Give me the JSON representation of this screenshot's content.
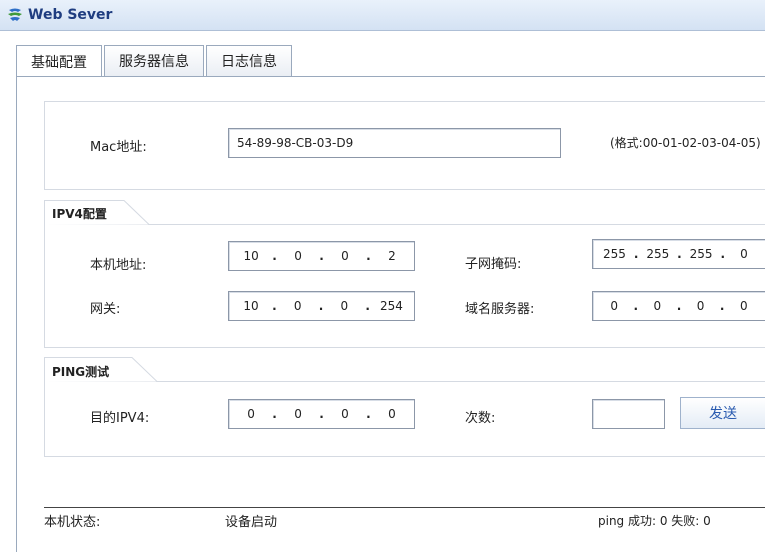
{
  "window": {
    "title": "Web Sever"
  },
  "tabs": [
    {
      "label": "基础配置",
      "active": true
    },
    {
      "label": "服务器信息",
      "active": false
    },
    {
      "label": "日志信息",
      "active": false
    }
  ],
  "mac": {
    "label": "Mac地址:",
    "value": "54-89-98-CB-03-D9",
    "hint": "(格式:00-01-02-03-04-05)"
  },
  "ipv4": {
    "title": "IPV4配置",
    "host_label": "本机地址:",
    "host": [
      "10",
      "0",
      "0",
      "2"
    ],
    "mask_label": "子网掩码:",
    "mask": [
      "255",
      "255",
      "255",
      "0"
    ],
    "gw_label": "网关:",
    "gateway": [
      "10",
      "0",
      "0",
      "254"
    ],
    "dns_label": "域名服务器:",
    "dns": [
      "0",
      "0",
      "0",
      "0"
    ]
  },
  "ping": {
    "title": "PING测试",
    "target_label": "目的IPV4:",
    "target": [
      "0",
      "0",
      "0",
      "0"
    ],
    "count_label": "次数:",
    "count": "",
    "send_label": "发送"
  },
  "status": {
    "label": "本机状态:",
    "value": "设备启动",
    "ping_result": "ping 成功: 0 失败: 0"
  }
}
